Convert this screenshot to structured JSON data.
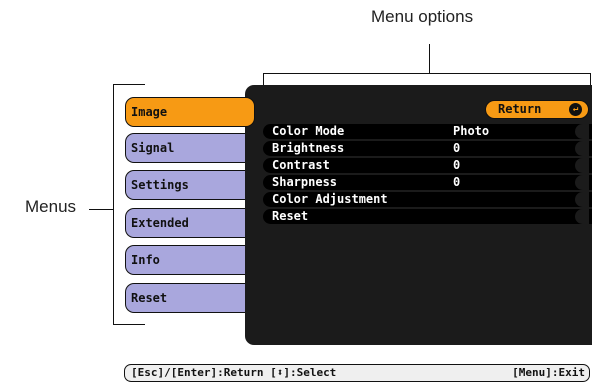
{
  "callouts": {
    "menu_options": "Menu options",
    "menus": "Menus"
  },
  "menus": [
    {
      "label": "Image",
      "active": true
    },
    {
      "label": "Signal",
      "active": false
    },
    {
      "label": "Settings",
      "active": false
    },
    {
      "label": "Extended",
      "active": false
    },
    {
      "label": "Info",
      "active": false
    },
    {
      "label": "Reset",
      "active": false
    }
  ],
  "return_button": {
    "label": "Return",
    "icon": "enter-icon"
  },
  "options": [
    {
      "label": "Color Mode",
      "value": "Photo"
    },
    {
      "label": "Brightness",
      "value": "0"
    },
    {
      "label": "Contrast",
      "value": "0"
    },
    {
      "label": "Sharpness",
      "value": "0"
    },
    {
      "label": "Color Adjustment",
      "value": ""
    },
    {
      "label": "Reset",
      "value": ""
    }
  ],
  "help_bar": {
    "esc_enter": "[Esc]/[Enter]:Return",
    "select_prefix": "[",
    "select_icon": "up-down-arrow-icon",
    "select_suffix": "]:Select",
    "menu_exit": "[Menu]:Exit"
  },
  "colors": {
    "accent_orange": "#f79a14",
    "tab_lavender": "#a9a7dd",
    "panel_dark": "#1b1b1b",
    "row_black": "#000000"
  }
}
